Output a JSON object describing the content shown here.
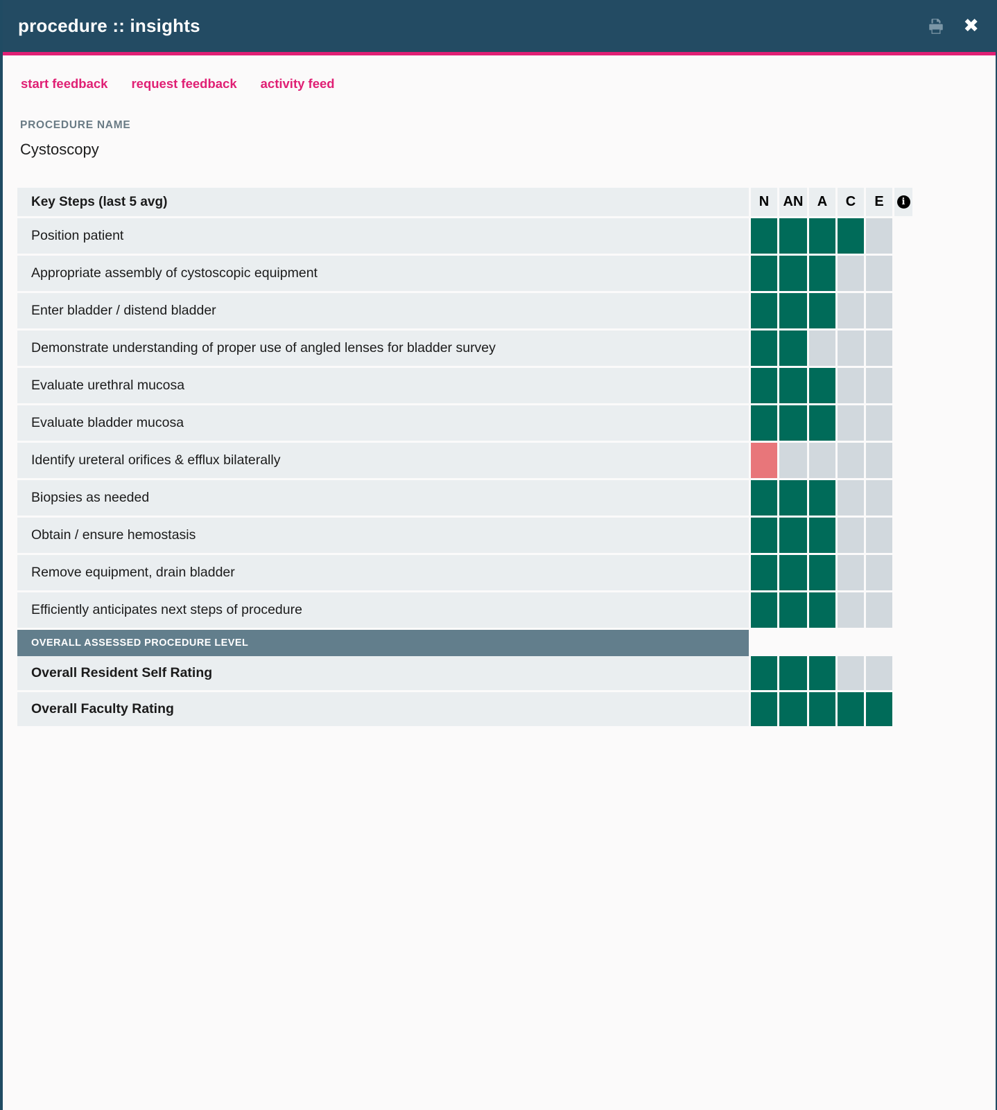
{
  "window": {
    "title": "procedure :: insights",
    "print_icon": "printer-icon",
    "close_icon": "✖",
    "accent_color": "#e01f74",
    "titlebar_color": "#234b63"
  },
  "nav": {
    "links": [
      {
        "label": "start feedback"
      },
      {
        "label": "request feedback"
      },
      {
        "label": "activity feed"
      }
    ]
  },
  "procedure": {
    "label": "PROCEDURE NAME",
    "name": "Cystoscopy"
  },
  "table": {
    "title": "Key Steps (last 5 avg)",
    "columns": [
      "N",
      "AN",
      "A",
      "C",
      "E"
    ],
    "info_icon": "i",
    "section_band": "OVERALL ASSESSED PROCEDURE LEVEL",
    "colors": {
      "filled": "#006b59",
      "alert": "#e8767a",
      "empty": "#d1d8dd",
      "row_bg": "#eaeef0",
      "band_bg": "#627e8c"
    },
    "rows": [
      {
        "label": "Position patient",
        "cells": [
          "teal",
          "teal",
          "teal",
          "teal",
          "gray"
        ]
      },
      {
        "label": "Appropriate assembly of cystoscopic equipment",
        "cells": [
          "teal",
          "teal",
          "teal",
          "gray",
          "gray"
        ]
      },
      {
        "label": "Enter bladder / distend bladder",
        "cells": [
          "teal",
          "teal",
          "teal",
          "gray",
          "gray"
        ]
      },
      {
        "label": "Demonstrate understanding of proper use of angled lenses for bladder survey",
        "cells": [
          "teal",
          "teal",
          "gray",
          "gray",
          "gray"
        ]
      },
      {
        "label": "Evaluate urethral mucosa",
        "cells": [
          "teal",
          "teal",
          "teal",
          "gray",
          "gray"
        ]
      },
      {
        "label": "Evaluate bladder mucosa",
        "cells": [
          "teal",
          "teal",
          "teal",
          "gray",
          "gray"
        ]
      },
      {
        "label": "Identify ureteral orifices & efflux bilaterally",
        "cells": [
          "red",
          "gray",
          "gray",
          "gray",
          "gray"
        ]
      },
      {
        "label": "Biopsies as needed",
        "cells": [
          "teal",
          "teal",
          "teal",
          "gray",
          "gray"
        ]
      },
      {
        "label": "Obtain / ensure hemostasis",
        "cells": [
          "teal",
          "teal",
          "teal",
          "gray",
          "gray"
        ]
      },
      {
        "label": "Remove equipment, drain bladder",
        "cells": [
          "teal",
          "teal",
          "teal",
          "gray",
          "gray"
        ]
      },
      {
        "label": "Efficiently anticipates next steps of procedure",
        "cells": [
          "teal",
          "teal",
          "teal",
          "gray",
          "gray"
        ]
      }
    ],
    "rating_rows": [
      {
        "label": "Overall Resident Self Rating",
        "cells": [
          "teal",
          "teal",
          "teal",
          "gray",
          "gray"
        ]
      },
      {
        "label": "Overall Faculty Rating",
        "cells": [
          "teal",
          "teal",
          "teal",
          "teal",
          "teal"
        ]
      }
    ]
  }
}
